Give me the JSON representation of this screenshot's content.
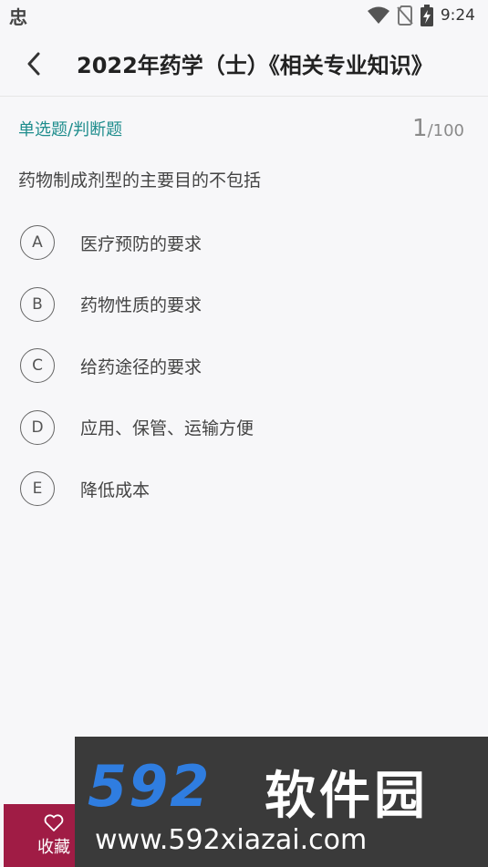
{
  "status_bar": {
    "app_notification_glyph": "忠",
    "time": "9:24",
    "icons": [
      "wifi-icon",
      "no-sim-icon",
      "battery-charging-icon"
    ]
  },
  "nav": {
    "back_icon": "chevron-left-icon",
    "title": "2022年药学（士）《相关专业知识》"
  },
  "question": {
    "type": "单选题/判断题",
    "current": "1",
    "sep": "/",
    "total": "100",
    "text": "药物制成剂型的主要目的不包括",
    "options": [
      {
        "letter": "A",
        "text": "医疗预防的要求"
      },
      {
        "letter": "B",
        "text": "药物性质的要求"
      },
      {
        "letter": "C",
        "text": "给药途径的要求"
      },
      {
        "letter": "D",
        "text": "应用、保管、运输方便"
      },
      {
        "letter": "E",
        "text": "降低成本"
      }
    ]
  },
  "bottom": {
    "favorite_icon": "heart-icon",
    "favorite_label": "收藏"
  },
  "watermark": {
    "brand_num": "592",
    "brand_cn": "软件园",
    "url": "www.592xiazai.com"
  },
  "colors": {
    "accent": "#1f8d8d",
    "favorite_bg": "#a01c45",
    "watermark_blue": "#2f7de0"
  }
}
